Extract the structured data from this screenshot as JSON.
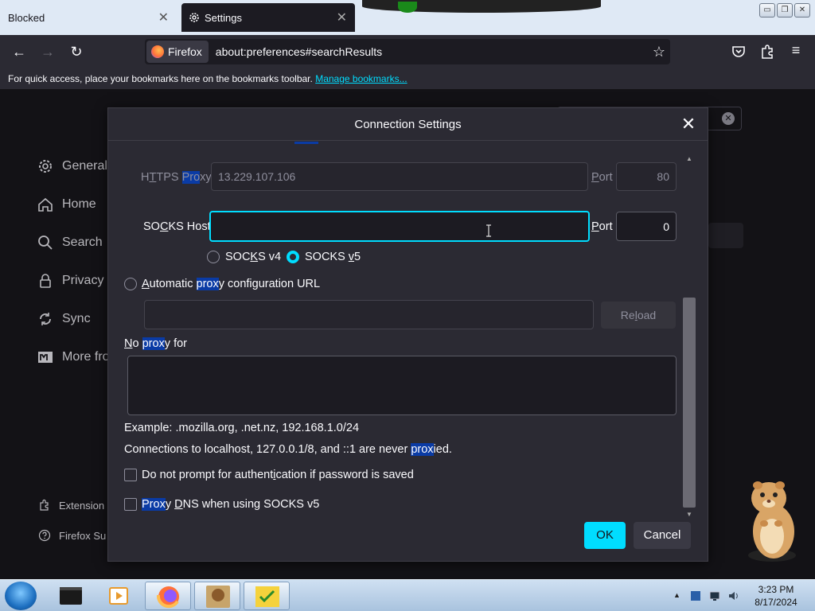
{
  "tabs": [
    {
      "title": "Blocked",
      "close": "✕"
    },
    {
      "title": "Settings",
      "close": "✕"
    }
  ],
  "window_buttons": {
    "minimize": "▭",
    "restore": "❐",
    "close": "✕"
  },
  "navbar": {
    "back": "←",
    "forward": "→",
    "reload": "↻",
    "identity_label": "Firefox",
    "url": "about:preferences#searchResults",
    "bookmark_star": "☆",
    "menu": "≡"
  },
  "bookmarks_bar": {
    "text": "For quick access, place your bookmarks here on the bookmarks toolbar.",
    "link": "Manage bookmarks..."
  },
  "sidebar": {
    "items": [
      {
        "label": "General",
        "icon": "gear-icon"
      },
      {
        "label": "Home",
        "icon": "home-icon"
      },
      {
        "label": "Search",
        "icon": "search-icon"
      },
      {
        "label": "Privacy &",
        "icon": "lock-icon"
      },
      {
        "label": "Sync",
        "icon": "sync-icon"
      },
      {
        "label": "More fro",
        "icon": "mozilla-icon"
      }
    ],
    "footer": [
      {
        "label": "Extension",
        "icon": "puzzle-icon"
      },
      {
        "label": "Firefox Su",
        "icon": "help-icon"
      }
    ]
  },
  "dialog": {
    "title": "Connection Settings",
    "close": "✕",
    "https_proxy": {
      "label_pre": "H",
      "label_u": "T",
      "label_mid": "TPS ",
      "label_hl": "Pro",
      "label_post": "xy",
      "value": "13.229.107.106",
      "port_label_u": "P",
      "port_label_rest": "ort",
      "port_value": "80"
    },
    "socks_host": {
      "label_pre": "SO",
      "label_u": "C",
      "label_post": "KS Host",
      "value": "",
      "port_label_u": "P",
      "port_label_rest": "ort",
      "port_value": "0"
    },
    "socks_v4": {
      "label_pre": "SOC",
      "label_u": "K",
      "label_post": "S v4",
      "selected": false
    },
    "socks_v5": {
      "label_pre": "SOCKS ",
      "label_u": "v",
      "label_post": "5",
      "selected": true
    },
    "auto_proxy": {
      "label_pre": "",
      "label_u": "A",
      "label_mid": "utomatic ",
      "label_hl": "prox",
      "label_post": "y configuration URL",
      "value": "",
      "reload_u": "l",
      "reload_pre": "Re",
      "reload_post": "oad"
    },
    "no_proxy": {
      "label_u": "N",
      "label_mid": "o ",
      "label_hl": "prox",
      "label_post": "y for",
      "value": ""
    },
    "example": "Example: .mozilla.org, .net.nz, 192.168.1.0/24",
    "localhost_note_pre": "Connections to localhost, 127.0.0.1/8, and ::1 are never ",
    "localhost_note_hl": "prox",
    "localhost_note_post": "ied.",
    "no_auth_prompt": {
      "label_pre": "Do not prompt for authent",
      "label_u": "i",
      "label_post": "cation if password is saved",
      "checked": false
    },
    "proxy_dns": {
      "label_hl": "Prox",
      "label_mid": "y ",
      "label_u": "D",
      "label_post": "NS when using SOCKS v5",
      "checked": false
    },
    "ok": "OK",
    "cancel": "Cancel"
  },
  "taskbar": {
    "time": "3:23 PM",
    "date": "8/17/2024"
  },
  "colors": {
    "accent": "#00ddff",
    "highlight": "#0a3ba5",
    "dialog_bg": "#2b2a33"
  }
}
